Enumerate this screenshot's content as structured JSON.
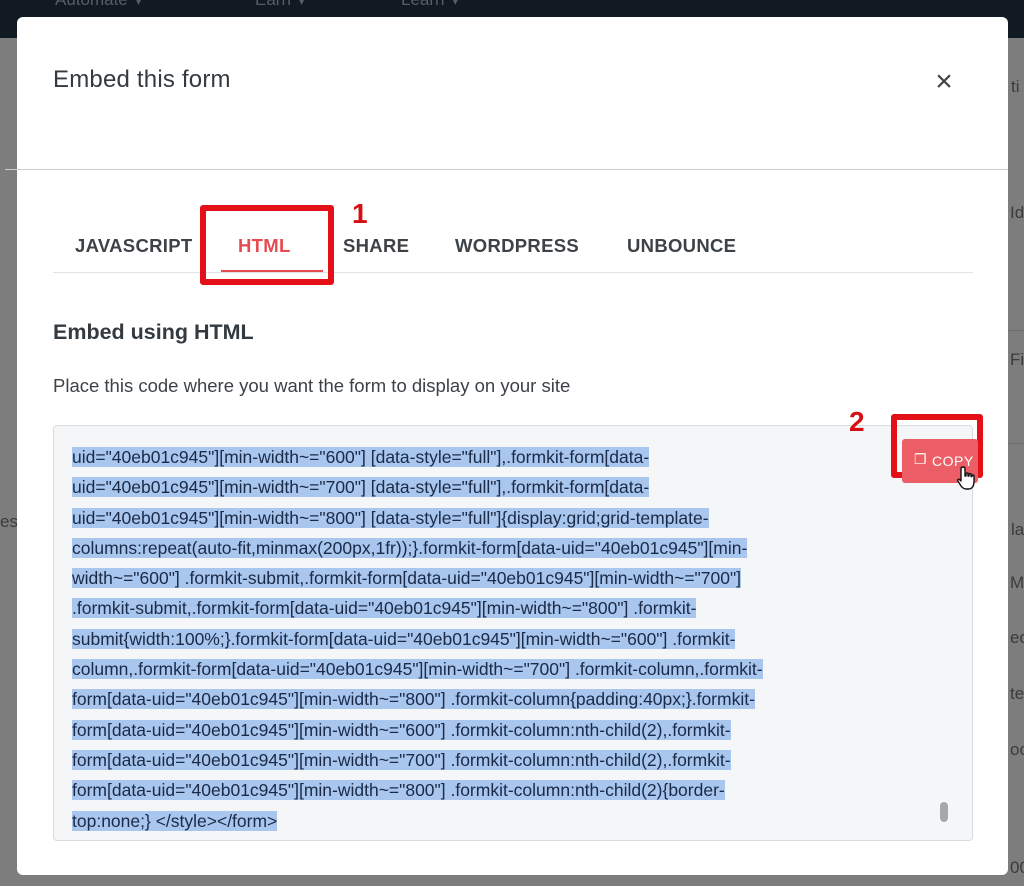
{
  "background": {
    "nav_items": [
      "Automate",
      "Earn",
      "Learn"
    ],
    "side_fragments": [
      "ti",
      "Id",
      "Fi",
      "la",
      "M",
      "ed",
      "te",
      "oo",
      "00",
      "es"
    ]
  },
  "modal": {
    "title": "Embed this form",
    "close_icon": "close-icon"
  },
  "tabs": [
    {
      "label": "JAVASCRIPT",
      "active": false
    },
    {
      "label": "HTML",
      "active": true
    },
    {
      "label": "SHARE",
      "active": false
    },
    {
      "label": "WORDPRESS",
      "active": false
    },
    {
      "label": "UNBOUNCE",
      "active": false
    }
  ],
  "annotations": {
    "marker_1": "1",
    "marker_2": "2",
    "color": "#e31117"
  },
  "embed": {
    "title": "Embed using HTML",
    "description": "Place this code where you want the form to display on your site",
    "copy_label": "COPY",
    "copy_icon": "copy-icon",
    "code_lines": [
      "uid=\"40eb01c945\"][min-width~=\"600\"] [data-style=\"full\"],.formkit-form[data-",
      "uid=\"40eb01c945\"][min-width~=\"700\"] [data-style=\"full\"],.formkit-form[data-",
      "uid=\"40eb01c945\"][min-width~=\"800\"] [data-style=\"full\"]{display:grid;grid-template-",
      "columns:repeat(auto-fit,minmax(200px,1fr));}.formkit-form[data-uid=\"40eb01c945\"][min-",
      "width~=\"600\"] .formkit-submit,.formkit-form[data-uid=\"40eb01c945\"][min-width~=\"700\"]",
      ".formkit-submit,.formkit-form[data-uid=\"40eb01c945\"][min-width~=\"800\"] .formkit-",
      "submit{width:100%;}.formkit-form[data-uid=\"40eb01c945\"][min-width~=\"600\"] .formkit-",
      "column,.formkit-form[data-uid=\"40eb01c945\"][min-width~=\"700\"] .formkit-column,.formkit-",
      "form[data-uid=\"40eb01c945\"][min-width~=\"800\"] .formkit-column{padding:40px;}.formkit-",
      "form[data-uid=\"40eb01c945\"][min-width~=\"600\"] .formkit-column:nth-child(2),.formkit-",
      "form[data-uid=\"40eb01c945\"][min-width~=\"700\"] .formkit-column:nth-child(2),.formkit-",
      "form[data-uid=\"40eb01c945\"][min-width~=\"800\"] .formkit-column:nth-child(2){border-",
      "top:none;} </style></form>"
    ]
  },
  "colors": {
    "accent": "#e64b52",
    "copy_button": "#ec5e65",
    "selection": "#a8c6ee",
    "code_text": "#1b2a47"
  }
}
